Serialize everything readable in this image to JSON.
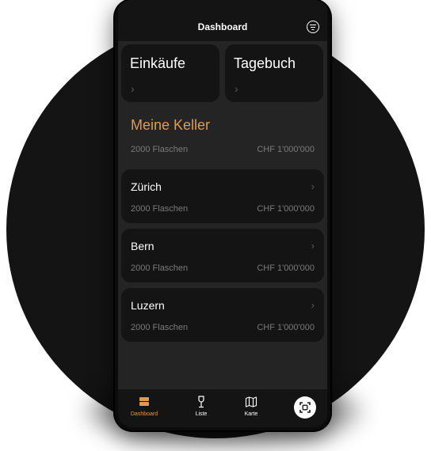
{
  "header": {
    "title": "Dashboard",
    "filter_icon": "filter-icon"
  },
  "tiles": [
    {
      "title": "Einkäufe",
      "chevron": "›"
    },
    {
      "title": "Tagebuch",
      "chevron": "›"
    }
  ],
  "cellar": {
    "title": "Meine Keller",
    "total_bottles": "2000 Flaschen",
    "total_value": "CHF 1'000'000"
  },
  "locations": [
    {
      "name": "Zürich",
      "bottles": "2000 Flaschen",
      "value": "CHF 1'000'000",
      "chevron": "›"
    },
    {
      "name": "Bern",
      "bottles": "2000 Flaschen",
      "value": "CHF 1'000'000",
      "chevron": "›"
    },
    {
      "name": "Luzern",
      "bottles": "2000 Flaschen",
      "value": "CHF 1'000'000",
      "chevron": "›"
    }
  ],
  "tabbar": {
    "items": [
      {
        "label": "Dashboard",
        "icon": "dashboard-icon",
        "active": true
      },
      {
        "label": "Liste",
        "icon": "wine-glass-icon",
        "active": false
      },
      {
        "label": "Karte",
        "icon": "map-icon",
        "active": false
      }
    ],
    "scan_icon": "scan-icon"
  },
  "colors": {
    "accent": "#e09a52",
    "card": "#141414",
    "screen": "#242424",
    "muted": "#7a7a7a"
  }
}
